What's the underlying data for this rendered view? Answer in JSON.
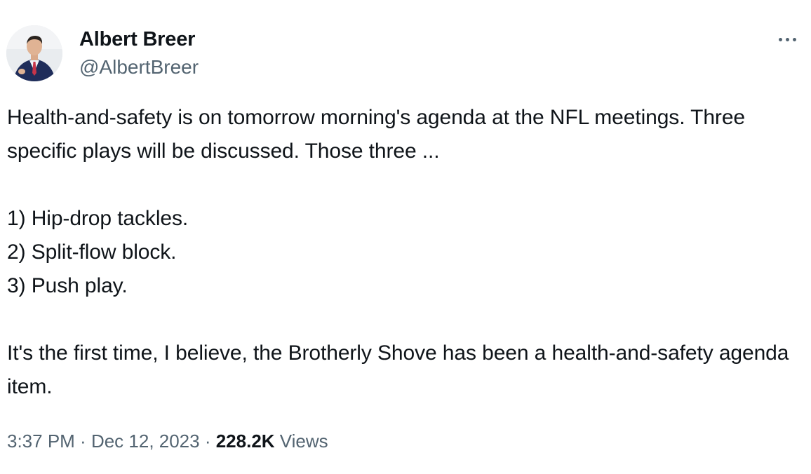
{
  "author": {
    "display_name": "Albert Breer",
    "handle": "@AlbertBreer",
    "avatar_icon": "user-avatar-photo"
  },
  "menu": {
    "more_icon": "more-horizontal-icon"
  },
  "tweet": {
    "paragraphs": [
      "Health-and-safety is on tomorrow morning's agenda at the NFL meetings. Three specific plays will be discussed. Those three ...",
      "1) Hip-drop tackles.\n2) Split-flow block.\n3) Push play.",
      "It's the first time, I believe, the Brotherly Shove has been a health-and-safety agenda item."
    ]
  },
  "meta": {
    "time": "3:37 PM",
    "separator": " · ",
    "date": "Dec 12, 2023",
    "views_count": "228.2K",
    "views_label": " Views"
  },
  "colors": {
    "text_primary": "#0f1419",
    "text_secondary": "#536471",
    "background": "#ffffff"
  }
}
